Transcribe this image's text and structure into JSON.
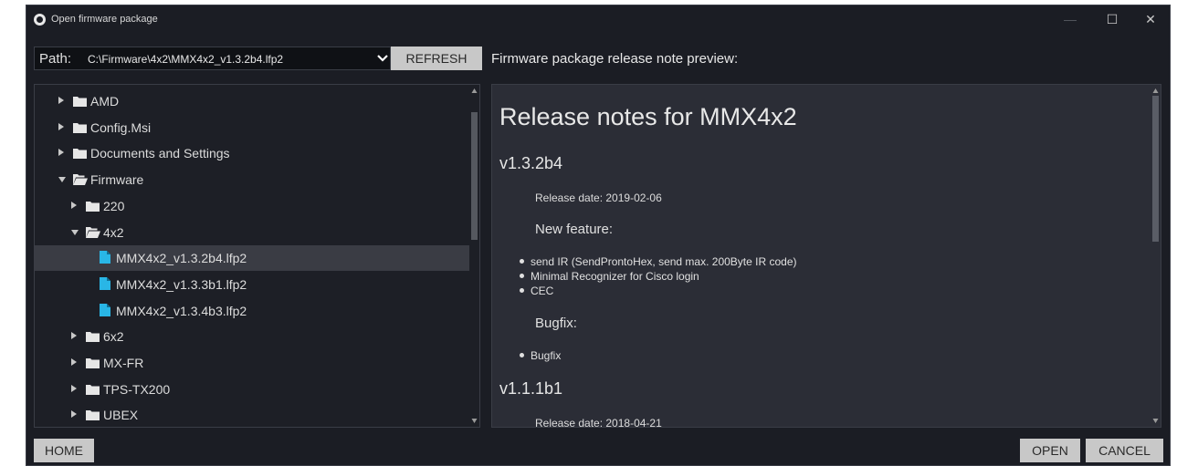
{
  "window": {
    "title": "Open firmware package",
    "minimize": "—",
    "maximize": "☐",
    "close": "✕"
  },
  "path_bar": {
    "label": "Path:",
    "value": "C:\\Firmware\\4x2\\MMX4x2_v1.3.2b4.lfp2",
    "refresh_label": "REFRESH"
  },
  "preview_label": "Firmware package release note preview:",
  "tree": {
    "items": [
      {
        "label": "AMD",
        "type": "folder",
        "expanded": false
      },
      {
        "label": "Config.Msi",
        "type": "folder",
        "expanded": false
      },
      {
        "label": "Documents and Settings",
        "type": "folder",
        "expanded": false
      },
      {
        "label": "Firmware",
        "type": "folder",
        "expanded": true
      },
      {
        "label": "220",
        "type": "folder",
        "expanded": false
      },
      {
        "label": "4x2",
        "type": "folder",
        "expanded": true
      },
      {
        "label": "MMX4x2_v1.3.2b4.lfp2",
        "type": "file",
        "selected": true
      },
      {
        "label": "MMX4x2_v1.3.3b1.lfp2",
        "type": "file"
      },
      {
        "label": "MMX4x2_v1.3.4b3.lfp2",
        "type": "file"
      },
      {
        "label": "6x2",
        "type": "folder",
        "expanded": false
      },
      {
        "label": "MX-FR",
        "type": "folder",
        "expanded": false
      },
      {
        "label": "TPS-TX200",
        "type": "folder",
        "expanded": false
      },
      {
        "label": "UBEX",
        "type": "folder",
        "expanded": false
      }
    ]
  },
  "release_notes": {
    "title": "Release notes for MMX4x2",
    "v1": {
      "version": "v1.3.2b4",
      "date": "Release date: 2019-02-06",
      "feature_heading": "New feature:",
      "features": [
        "send IR (SendProntoHex, send max. 200Byte IR code)",
        "Minimal Recognizer for Cisco login",
        "CEC"
      ],
      "bugfix_heading": "Bugfix:",
      "bugfixes": [
        "Bugfix"
      ]
    },
    "v2": {
      "version": "v1.1.1b1",
      "date": "Release date: 2018-04-21"
    }
  },
  "buttons": {
    "home": "HOME",
    "open": "OPEN",
    "cancel": "CANCEL"
  },
  "colors": {
    "background": "#1b1d24",
    "panel": "#2b2d36",
    "button": "#c8c8c8",
    "file_icon": "#29b6e6",
    "selection": "#3a3c44"
  }
}
